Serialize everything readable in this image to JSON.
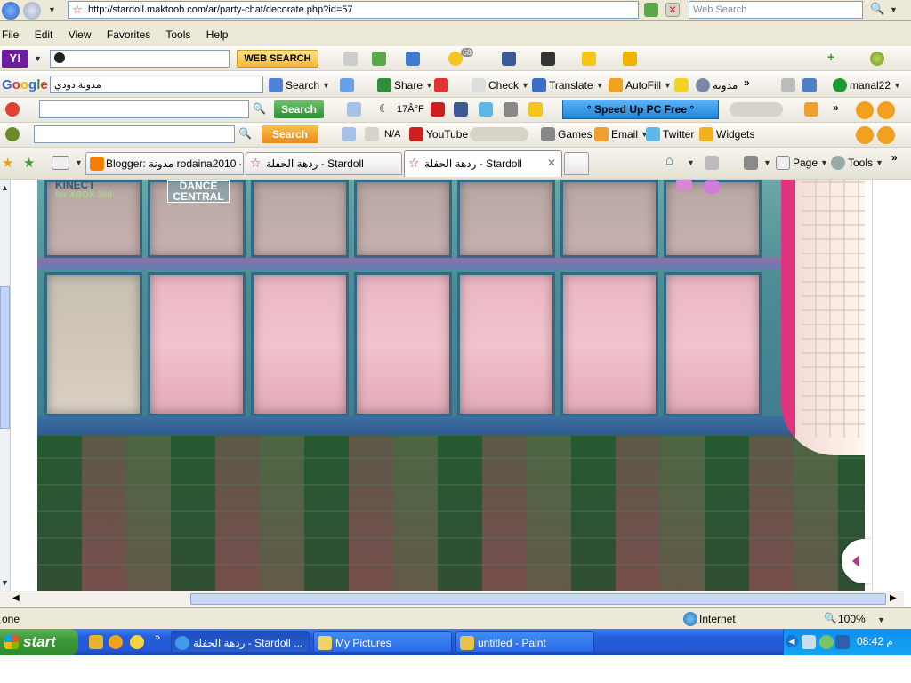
{
  "address_bar": {
    "url": "http://stardoll.maktoob.com/ar/party-chat/decorate.php?id=57",
    "search_placeholder": "Web Search"
  },
  "menu": [
    "File",
    "Edit",
    "View",
    "Favorites",
    "Tools",
    "Help"
  ],
  "yahoo_toolbar": {
    "web_search_label": "WEB SEARCH",
    "badge_count": "68"
  },
  "google_toolbar": {
    "search_value": "مدونة دودي",
    "search_label": "Search",
    "share_label": "Share",
    "check_label": "Check",
    "translate_label": "Translate",
    "autofill_label": "AutoFill",
    "blog_label": "مدونة",
    "user_label": "manal22"
  },
  "toolbar3": {
    "search_button": "Search",
    "weather": "17Â°F",
    "speedup_label": "° Speed Up PC Free °"
  },
  "toolbar4": {
    "search_button": "Search",
    "na_label": "N/A",
    "youtube_label": "YouTube",
    "games_label": "Games",
    "email_label": "Email",
    "twitter_label": "Twitter",
    "widgets_label": "Widgets"
  },
  "tabs": [
    {
      "label": "Blogger: مدونة rodaina2010 -..."
    },
    {
      "label": "ردهة الحفلة - Stardoll"
    },
    {
      "label": "ردهة الحفلة - Stardoll"
    }
  ],
  "command_bar": {
    "page_label": "Page",
    "tools_label": "Tools"
  },
  "scene": {
    "logo1_line1": "KINECT",
    "logo1_line2": "for XBOX 360",
    "logo2_line1": "DANCE",
    "logo2_line2": "CENTRAL"
  },
  "status_bar": {
    "status_text": "one",
    "zone": "Internet",
    "zoom": "100%"
  },
  "taskbar": {
    "start_label": "start",
    "tasks": [
      {
        "label": "ردهة الحفلة - Stardoll ..."
      },
      {
        "label": "My Pictures"
      },
      {
        "label": "untitled - Paint"
      }
    ],
    "clock": "08:42 م"
  },
  "colors": {
    "taskbar_blue": "#245edb",
    "start_green": "#3c9a3a",
    "stardoll_pink": "#e0347d"
  }
}
